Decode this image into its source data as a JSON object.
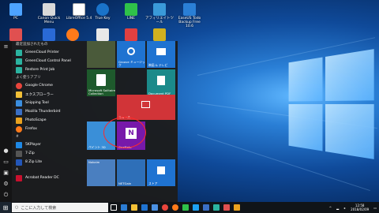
{
  "desktop_icons": [
    {
      "label": "PC",
      "color": "#4da3ff"
    },
    {
      "label": "Canon Quick Menu",
      "color": "#d9d9d9"
    },
    {
      "label": "LibreOffice 5.4",
      "color": "#ffffff"
    },
    {
      "label": "True Key",
      "color": "#1a73c9"
    },
    {
      "label": "LINE",
      "color": "#2fc24a"
    },
    {
      "label": "アフィリエイトツール",
      "color": "#3a9ad9"
    },
    {
      "label": "EaseUS Todo Backup Free 10.6",
      "color": "#2a7fd6"
    }
  ],
  "start_menu": {
    "recent_header": "最近追加されたもの",
    "recent_apps": [
      {
        "label": "GreenCloud Printer",
        "color": "#2bb3a0"
      },
      {
        "label": "GreenCloud Control Panel",
        "color": "#2bb3a0"
      },
      {
        "label": "Restore Print Job",
        "color": "#2bb3a0"
      }
    ],
    "frequent_header": "よく使うアプリ",
    "frequent_apps": [
      {
        "label": "Google Chrome",
        "color": "#e8453c"
      },
      {
        "label": "エクスプローラー",
        "color": "#f2c037"
      },
      {
        "label": "Snipping Tool",
        "color": "#3b8ede"
      },
      {
        "label": "Mozilla Thunderbird",
        "color": "#3a6fc4"
      },
      {
        "label": "PhotoScape",
        "color": "#e9a21f"
      },
      {
        "label": "Firefox",
        "color": "#ff7a1a"
      }
    ],
    "letter_header": "#",
    "letter_apps": [
      {
        "label": "5KPlayer",
        "color": "#1e88e5"
      },
      {
        "label": "7-Zip",
        "color": "#555555"
      },
      {
        "label": "8 Zip Lite",
        "color": "#2356b8"
      }
    ],
    "letter_a": "A",
    "a_apps": [
      {
        "label": "Acrobat Reader DC",
        "color": "#c8102e"
      }
    ]
  },
  "tiles": {
    "groove": "Groove ミュージック",
    "movies": "映画 & テレビ",
    "solitaire": "Microsoft Solitaire Collection",
    "pdf": "Document PDF",
    "news": "ニュース",
    "paint": "ペイント 3D",
    "onenote": "OneNote",
    "network": "Nokaim",
    "network2": "NETGain",
    "store": "ストア"
  },
  "taskbar": {
    "search_placeholder": "ここに入力して検索",
    "clock_time": "12:58",
    "clock_date": "2018/02/09"
  }
}
